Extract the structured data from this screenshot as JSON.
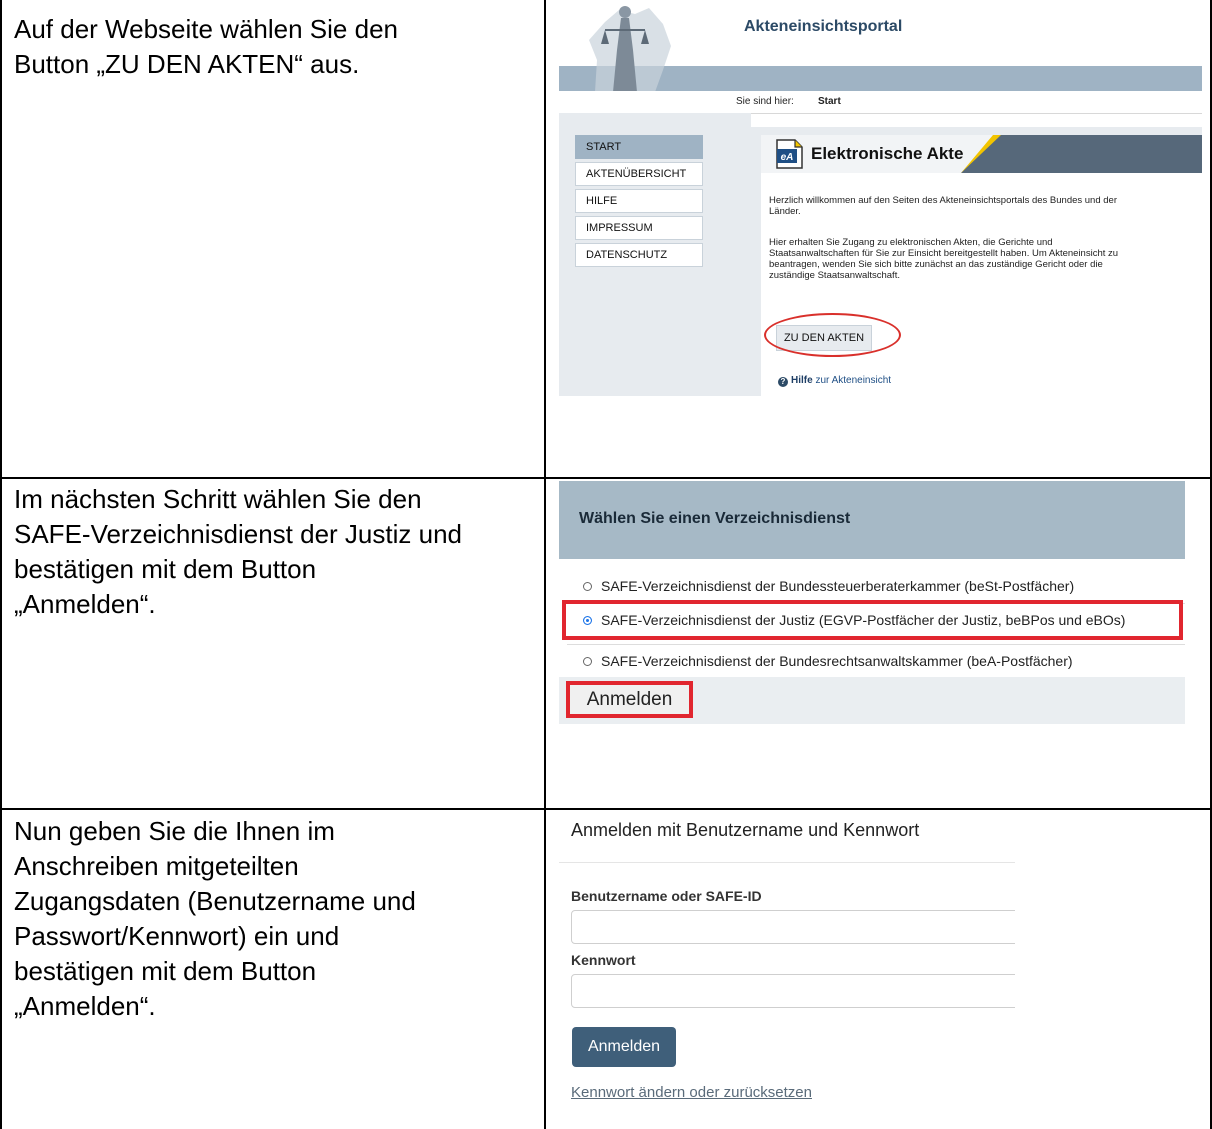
{
  "rows": [
    {
      "instruction": "Auf der Webseite wählen Sie den\nButton „ZU DEN AKTEN“ aus."
    },
    {
      "instruction": "Im nächsten Schritt wählen Sie den\nSAFE-Verzeichnisdienst der Justiz und\nbestätigen mit dem Button\n„Anmelden“."
    },
    {
      "instruction": "Nun geben Sie die Ihnen im\nAnschreiben mitgeteilten\nZugangsdaten (Benutzername und\nPasswort/Kennwort) ein und\nbestätigen mit dem Button\n„Anmelden“."
    }
  ],
  "portal": {
    "title": "Akteneinsichtsportal",
    "breadcrumb_label": "Sie sind hier:",
    "breadcrumb_current": "Start",
    "menu": [
      "START",
      "AKTENÜBERSICHT",
      "HILFE",
      "IMPRESSUM",
      "DATENSCHUTZ"
    ],
    "active_menu": "START",
    "section_icon": "eA",
    "section_title": "Elektronische Akte",
    "welcome": "Herzlich willkommen auf den Seiten des Akteneinsichtsportals des Bundes und der\nLänder.",
    "description": "Hier erhalten Sie Zugang zu elektronischen Akten, die Gerichte und\nStaatsanwaltschaften für Sie zur Einsicht bereitgestellt haben. Um Akteneinsicht zu\nbeantragen, wenden Sie sich bitte zunächst an das zuständige Gericht oder die\nzuständige Staatsanwaltschaft.",
    "button": "ZU DEN AKTEN",
    "help_icon": "?",
    "help_bold": "Hilfe",
    "help_rest": " zur Akteneinsicht"
  },
  "directory": {
    "heading": "Wählen Sie einen Verzeichnisdienst",
    "options": [
      {
        "label": "SAFE-Verzeichnisdienst der Bundessteuerberaterkammer (beSt-Postfächer)",
        "selected": false
      },
      {
        "label": "SAFE-Verzeichnisdienst der Justiz (EGVP-Postfächer der Justiz, beBPos und eBOs)",
        "selected": true
      },
      {
        "label": "SAFE-Verzeichnisdienst der Bundesrechtsanwaltskammer (beA-Postfächer)",
        "selected": false
      }
    ],
    "button": "Anmelden"
  },
  "login": {
    "title": "Anmelden mit Benutzername und Kennwort",
    "username_label": "Benutzername oder SAFE-ID",
    "username_value": "",
    "password_label": "Kennwort",
    "password_value": "",
    "button": "Anmelden",
    "reset_link": "Kennwort ändern oder zurücksetzen"
  },
  "colors": {
    "highlight_red": "#e1262f",
    "portal_slate": "#56687a",
    "portal_accent_yellow": "#f2c400",
    "login_button": "#3f5f7a"
  }
}
